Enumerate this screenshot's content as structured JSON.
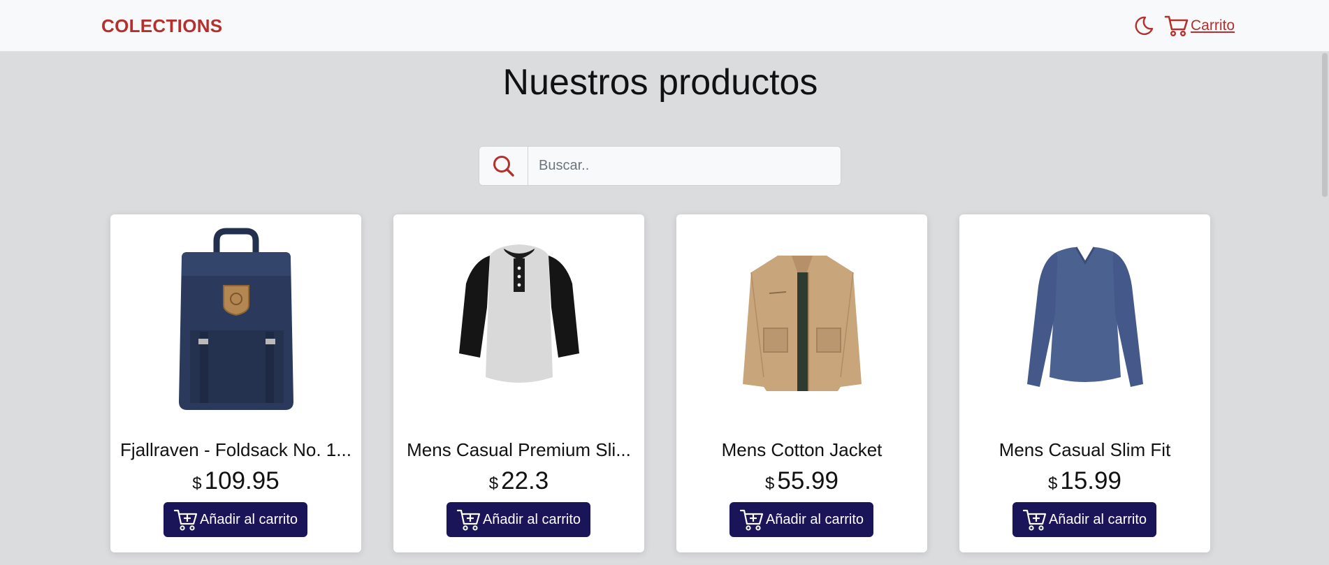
{
  "navbar": {
    "brand": "COLECTIONS",
    "theme_icon": "moon-icon",
    "cart_icon": "cart-icon",
    "cart_label": "Carrito"
  },
  "main": {
    "title": "Nuestros productos",
    "search": {
      "placeholder": "Buscar..",
      "value": "",
      "icon": "search-icon"
    }
  },
  "products": [
    {
      "name": "Fjallraven - Foldsack No. 1...",
      "currency": "$",
      "price": "109.95",
      "button_label": "Añadir al carrito",
      "image": "backpack-image"
    },
    {
      "name": "Mens Casual Premium Sli...",
      "currency": "$",
      "price": "22.3",
      "button_label": "Añadir al carrito",
      "image": "raglan-tshirt-image"
    },
    {
      "name": "Mens Cotton Jacket",
      "currency": "$",
      "price": "55.99",
      "button_label": "Añadir al carrito",
      "image": "cotton-jacket-image"
    },
    {
      "name": "Mens Casual Slim Fit",
      "currency": "$",
      "price": "15.99",
      "button_label": "Añadir al carrito",
      "image": "longsleeve-shirt-image"
    }
  ],
  "colors": {
    "brand": "#b5302c",
    "button": "#191558",
    "background": "#dbdcde",
    "navbar": "#f8f9fa"
  }
}
